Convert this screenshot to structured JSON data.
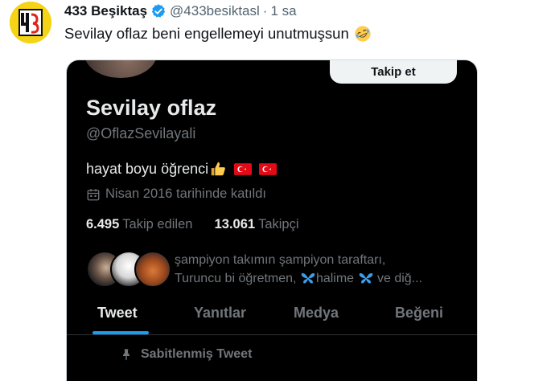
{
  "tweet": {
    "display_name": "433 Beşiktaş",
    "handle": "@433besiktasl",
    "separator": "·",
    "time": "1 sa",
    "text": "Sevilay oflaz beni engellemeyi unutmuşsun",
    "emoji": "rolling-on-floor-laughing",
    "verified_color": "#1d9bf0"
  },
  "embedded_profile": {
    "follow_button": "Takip et",
    "name": "Sevilay oflaz",
    "handle": "@OflazSevilayali",
    "bio": "hayat boyu öğrenci",
    "bio_emojis": [
      "thumbs-up",
      "turkish-flag",
      "turkish-flag"
    ],
    "joined": "Nisan 2016 tarihinde katıldı",
    "stats": {
      "following_count": "6.495",
      "following_label": "Takip edilen",
      "followers_count": "13.061",
      "followers_label": "Takipçi"
    },
    "followed_by": {
      "line1": "şampiyon takımın şampiyon taraftarı,",
      "line2_a": "Turuncu bi öğretmen,",
      "line2_b": "halime",
      "line2_c": "ve diğ..."
    },
    "tabs": [
      "Tweet",
      "Yanıtlar",
      "Medya",
      "Beğeni"
    ],
    "active_tab": "Tweet",
    "pinned_label": "Sabitlenmiş Tweet"
  },
  "colors": {
    "accent": "#1d9bf0",
    "dark_bg": "#000000",
    "muted_text": "#71767b"
  }
}
